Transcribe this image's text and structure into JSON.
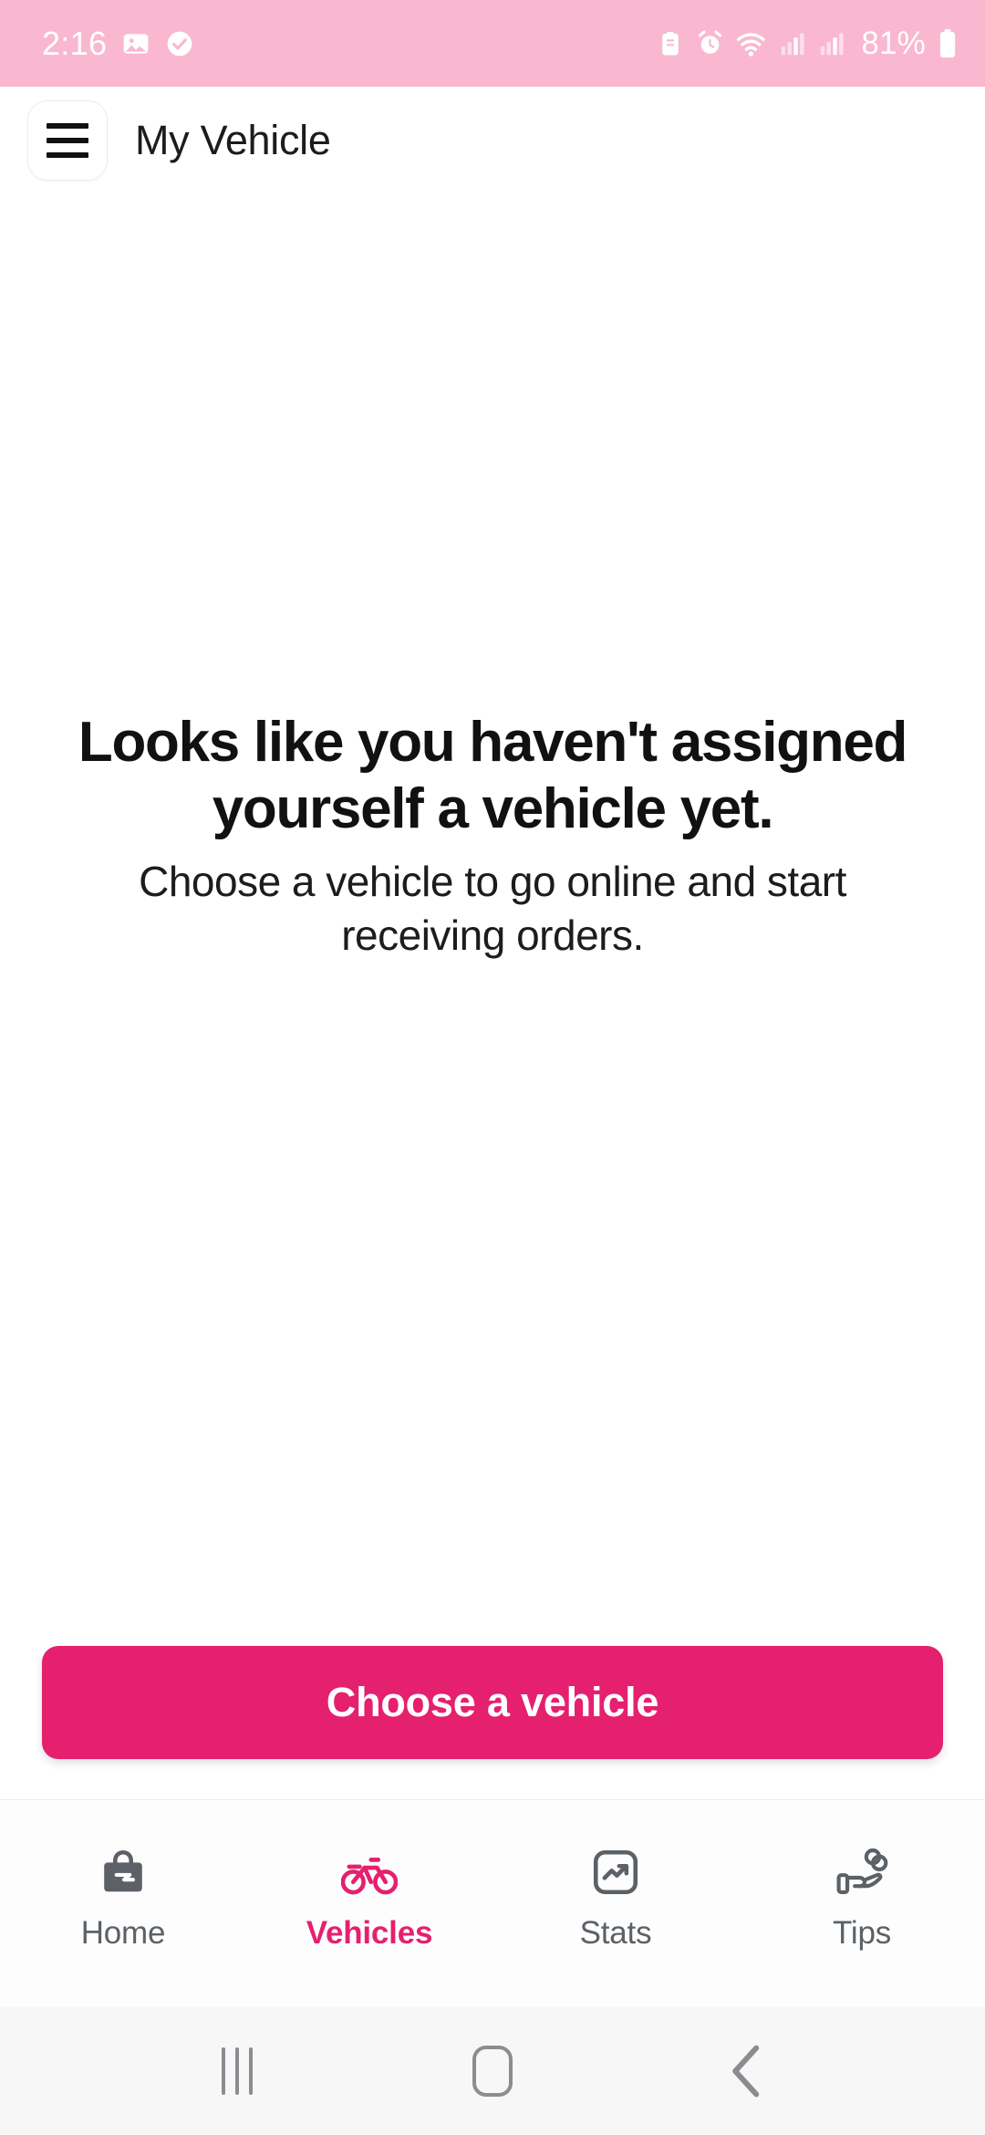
{
  "status_bar": {
    "time": "2:16",
    "battery_percent": "81%",
    "left_icons": [
      "photos-icon",
      "check-circle-icon"
    ],
    "right_icons": [
      "clipboard-icon",
      "alarm-clock-icon",
      "wifi-icon",
      "signal-bars-icon-1",
      "signal-bars-icon-2",
      "battery-icon"
    ],
    "background_color": "#f9b8d0",
    "foreground_color": "#ffffff"
  },
  "header": {
    "menu_icon": "hamburger-menu-icon",
    "title": "My Vehicle"
  },
  "main": {
    "empty_state": {
      "title": "Looks like you haven't assigned yourself a vehicle yet.",
      "subtitle": "Choose a vehicle to go online and start receiving orders."
    }
  },
  "cta": {
    "label": "Choose a vehicle",
    "color": "#e5206e",
    "text_color": "#ffffff"
  },
  "bottom_nav": {
    "active_color": "#e5206e",
    "inactive_color": "#5b6166",
    "items": [
      {
        "label": "Home",
        "icon": "shopping-bag-icon",
        "active": false
      },
      {
        "label": "Vehicles",
        "icon": "bicycle-icon",
        "active": true
      },
      {
        "label": "Stats",
        "icon": "trending-up-icon",
        "active": false
      },
      {
        "label": "Tips",
        "icon": "hand-coins-icon",
        "active": false
      }
    ]
  },
  "android_nav": {
    "recents_label": "recents-icon",
    "home_label": "home-icon",
    "back_label": "back-icon"
  }
}
